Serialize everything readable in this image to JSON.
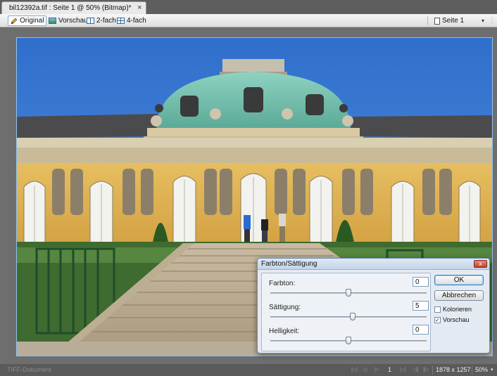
{
  "document_tab": {
    "title": "bil12392a.tif : Seite 1 @  50% (Bitmap)*",
    "close_symbol": "×"
  },
  "toolbar": {
    "original_label": "Original",
    "preview_label": "Vorschau",
    "split2_label": "2-fach",
    "split4_label": "4-fach",
    "page_label": "Seite 1"
  },
  "icons": {
    "pencil": "pencil-icon",
    "preview": "image-preview-icon",
    "split2": "split-two-icon",
    "split4": "split-four-icon",
    "page": "page-icon"
  },
  "dialog": {
    "title": "Farbton/Sättigung",
    "close_symbol": "x",
    "hue_label": "Farbton:",
    "hue_value": "0",
    "hue_level": 0.5,
    "saturation_label": "Sättigung:",
    "saturation_value": "5",
    "saturation_level": 0.525,
    "lightness_label": "Helligkeit:",
    "lightness_value": "0",
    "lightness_level": 0.5,
    "ok_label": "OK",
    "cancel_label": "Abbrechen",
    "colorize_label": "Kolorieren",
    "colorize_checked": false,
    "preview_label": "Vorschau",
    "preview_checked": true
  },
  "statusbar": {
    "document_type": "TIFF-Dokument",
    "first_symbol": "|◁",
    "prev_symbol": "◁",
    "next_symbol": "▷",
    "last_symbol": "▷|",
    "page_number": "1",
    "back_symbol": "◁|",
    "forward_symbol": "|▷",
    "dimensions": "1878 x 1257",
    "zoom": "50%"
  },
  "colors": {
    "sky": "#3e7fd6",
    "dome": "#7cc4b4",
    "facade": "#e2b755",
    "accent": "#3c7fb1"
  }
}
